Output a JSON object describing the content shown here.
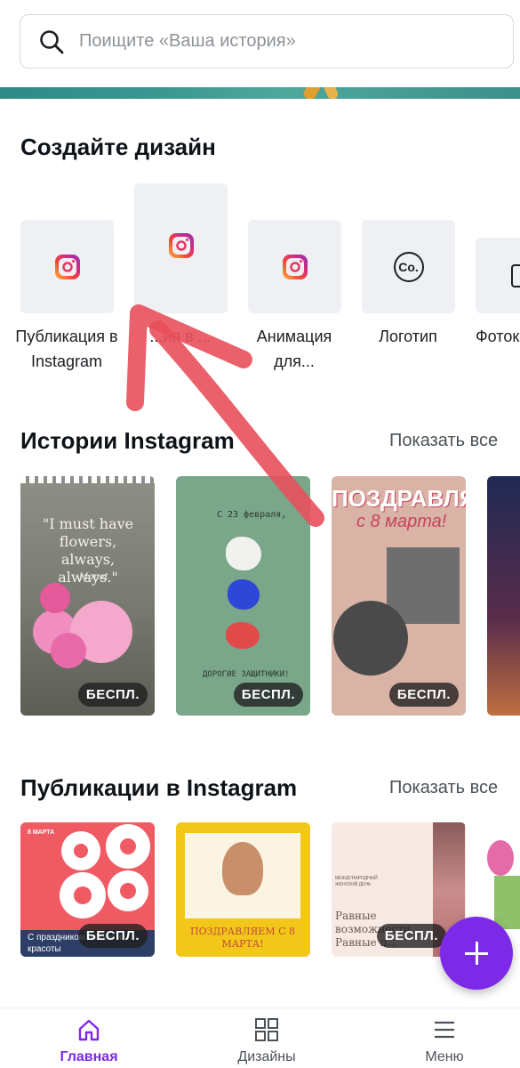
{
  "search": {
    "placeholder": "Поищите «Ваша история»"
  },
  "create": {
    "title": "Создайте дизайн",
    "items": [
      {
        "label": "Публикация в Instagram",
        "icon": "instagram-icon"
      },
      {
        "label": "...ия в ...",
        "icon": "instagram-icon"
      },
      {
        "label": "Анимация для...",
        "icon": "instagram-icon"
      },
      {
        "label": "Логотип",
        "icon": "logo-co-icon"
      },
      {
        "label": "Фотоко...",
        "icon": "photo-icon"
      }
    ]
  },
  "stories": {
    "title": "Истории Instagram",
    "show_all": "Показать все",
    "cards": [
      {
        "text": "\"I must have flowers, always, always.\"",
        "sub": "Monet",
        "badge": "БЕСПЛ."
      },
      {
        "text": "С 23 февраля,",
        "sub": "ДОРОГИЕ ЗАЩИТНИКИ!",
        "badge": "БЕСПЛ."
      },
      {
        "text": "ПОЗДРАВЛЯЮ",
        "sub": "с 8 марта!",
        "badge": "БЕСПЛ."
      },
      {
        "text": "",
        "sub": "",
        "badge": ""
      }
    ]
  },
  "posts": {
    "title": "Публикации в Instagram",
    "show_all": "Показать все",
    "cards": [
      {
        "tag": "8 МАРТА",
        "text": "С праздником любви и красоты",
        "badge": "БЕСПЛ."
      },
      {
        "text": "ПОЗДРАВЛЯЕМ С 8 МАРТА!",
        "badge": ""
      },
      {
        "small": "МЕЖДУНАРОДНЫЙ ЖЕНСКИЙ ДЕНЬ",
        "text": "Равные возможности Равные п...",
        "badge": "БЕСПЛ."
      },
      {
        "text": "",
        "badge": ""
      }
    ]
  },
  "nav": {
    "items": [
      {
        "label": "Главная",
        "icon": "home-icon",
        "active": true
      },
      {
        "label": "Дизайны",
        "icon": "grid-icon",
        "active": false
      },
      {
        "label": "Меню",
        "icon": "menu-icon",
        "active": false
      }
    ]
  },
  "colors": {
    "accent": "#7d2ae8",
    "annotation_arrow": "#e8505b"
  }
}
